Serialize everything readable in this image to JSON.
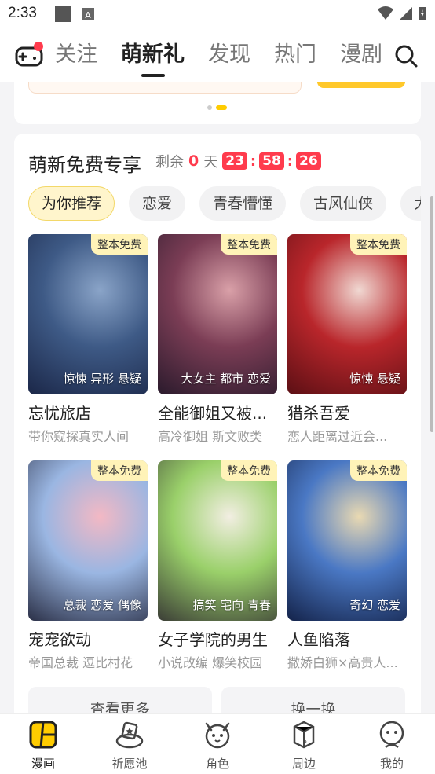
{
  "status_bar": {
    "time": "2:33"
  },
  "top_nav": {
    "tabs": [
      {
        "label": "关注"
      },
      {
        "label": "萌新礼"
      },
      {
        "label": "发现"
      },
      {
        "label": "热门"
      },
      {
        "label": "漫剧"
      }
    ],
    "active_tab": "萌新礼"
  },
  "free_section": {
    "title": "萌新免费专享",
    "remain_label": "剩余",
    "days": "0",
    "days_unit": "天",
    "hours": "23",
    "minutes": "58",
    "seconds": "26",
    "chips": [
      "为你推荐",
      "恋爱",
      "青春懵懂",
      "古风仙侠",
      "大"
    ],
    "active_chip": "为你推荐",
    "books": [
      {
        "badge": "整本免费",
        "tags": "惊悚 异形 悬疑",
        "title": "忘忧旅店",
        "desc": "带你窥探真实人间",
        "palette": [
          "#1b2748",
          "#3e5a86",
          "#8aa4c8"
        ]
      },
      {
        "badge": "整本免费",
        "tags": "大女主 都市 恋爱",
        "title": "全能御姐又被...",
        "desc": "高冷御姐 斯文败类",
        "palette": [
          "#2a1a2c",
          "#7b3d55",
          "#d9a0a8"
        ]
      },
      {
        "badge": "整本免费",
        "tags": "惊悚 悬疑",
        "title": "猎杀吾爱",
        "desc": "恋人距离过近会...",
        "palette": [
          "#5b0f14",
          "#b9262b",
          "#f0d8d2"
        ]
      },
      {
        "badge": "整本免费",
        "tags": "总裁 恋爱 偶像",
        "title": "宠宠欲动",
        "desc": "帝国总裁 逗比村花",
        "palette": [
          "#2b3047",
          "#9ab6e2",
          "#f3b8c4"
        ]
      },
      {
        "badge": "整本免费",
        "tags": "搞笑 宅向 青春",
        "title": "女子学院的男生",
        "desc": "小说改编 爆笑校园",
        "palette": [
          "#3b3d36",
          "#9ad06a",
          "#f2eee2"
        ]
      },
      {
        "badge": "整本免费",
        "tags": "奇幻 恋爱",
        "title": "人鱼陷落",
        "desc": "撒娇白狮×高贵人...",
        "palette": [
          "#14234a",
          "#4a78c4",
          "#e9d9b2"
        ]
      }
    ],
    "more_button": "查看更多",
    "refresh_button": "换一换"
  },
  "tab_bar": {
    "items": [
      {
        "label": "漫画",
        "icon": "comic-icon"
      },
      {
        "label": "祈愿池",
        "icon": "wish-pool-icon"
      },
      {
        "label": "角色",
        "icon": "character-icon"
      },
      {
        "label": "周边",
        "icon": "merch-icon"
      },
      {
        "label": "我的",
        "icon": "profile-icon"
      }
    ],
    "active": "漫画"
  },
  "colors": {
    "accent_yellow": "#ffcc00",
    "timer_red": "#ff3b4d"
  }
}
